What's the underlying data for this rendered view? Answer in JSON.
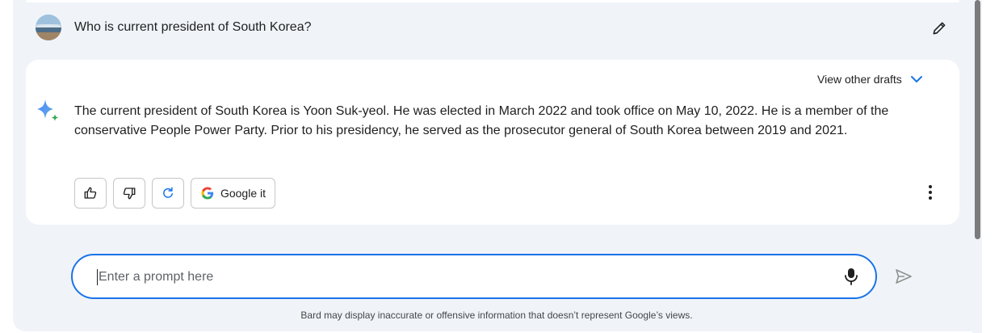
{
  "conversation": {
    "user_question": "Who is current president of South Korea?",
    "drafts_label": "View other drafts",
    "answer": "The current president of South Korea is Yoon Suk-yeol. He was elected in March 2022 and took office on May 10, 2022. He is a member of the conservative People Power Party. Prior to his presidency, he served as the prosecutor general of South Korea between 2019 and 2021."
  },
  "actions": {
    "google_it_label": "Google it",
    "icons": [
      "thumbs-up-icon",
      "thumbs-down-icon",
      "regenerate-icon",
      "google-g-icon",
      "more-vert-icon",
      "edit-pencil-icon",
      "sparkle-icon",
      "chevron-down-icon"
    ]
  },
  "prompt": {
    "placeholder": "Enter a prompt here",
    "value": "",
    "icons": [
      "microphone-icon",
      "send-icon"
    ]
  },
  "footer": {
    "disclaimer": "Bard may display inaccurate or offensive information that doesn’t represent Google’s views."
  },
  "colors": {
    "background": "#f0f4f9",
    "card": "#ffffff",
    "accent": "#1a73e8",
    "sparkle": "#4285f4"
  }
}
